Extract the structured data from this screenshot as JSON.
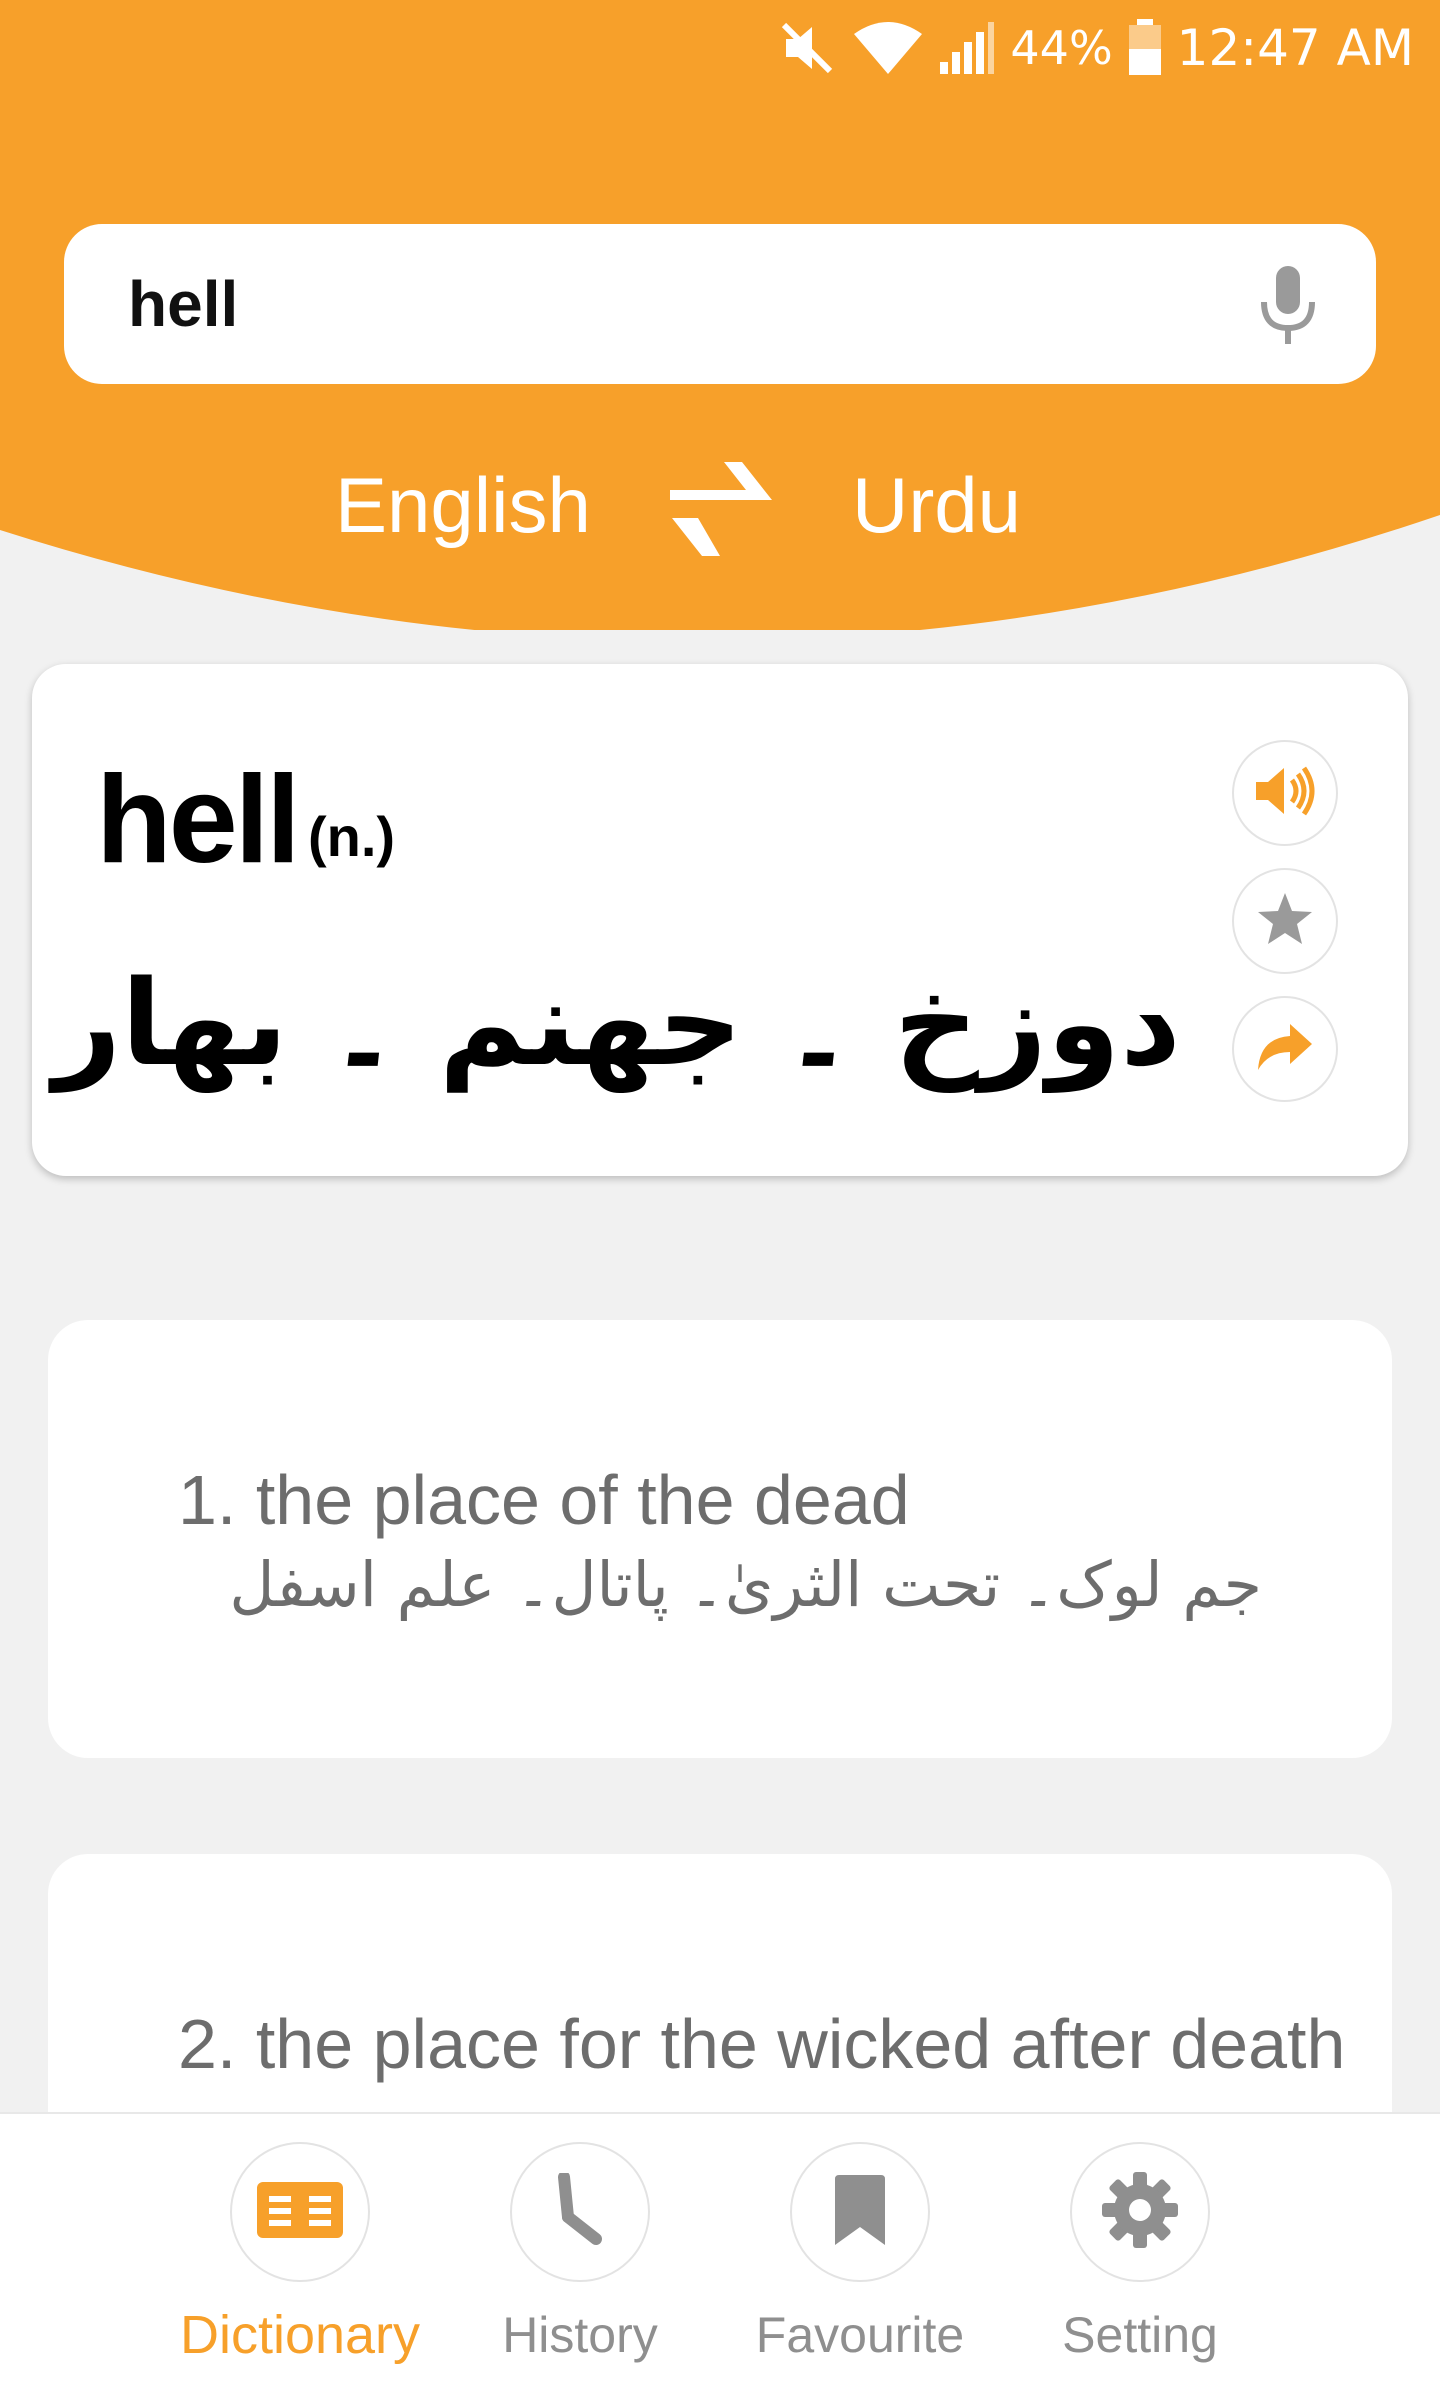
{
  "colors": {
    "accent": "#f7a02a",
    "header_bg": "#f7a02a",
    "page_bg": "#f1f1f1",
    "muted_icon": "#8f8f8f"
  },
  "status_bar": {
    "battery_percent": "44%",
    "time": "12:47 AM",
    "icons": [
      "mute-icon",
      "wifi-icon",
      "signal-icon",
      "battery-icon"
    ]
  },
  "search": {
    "value": "hell",
    "mic_icon": "mic-icon"
  },
  "languages": {
    "source": "English",
    "target": "Urdu",
    "swap_icon": "swap-arrows-icon"
  },
  "word_card": {
    "word": "hell",
    "part_of_speech": "(n.)",
    "translation": "دوزخ ۔ جھنم ۔ بھار",
    "actions": [
      "speaker-icon",
      "star-icon",
      "share-icon"
    ]
  },
  "meanings": [
    {
      "english": "1. the place of the dead",
      "urdu": "جم لوک۔ تحت الثریٰ۔ پاتال۔ علم اسفل"
    },
    {
      "english": "2. the place for the wicked after death"
    }
  ],
  "bottom_nav": {
    "items": [
      {
        "label": "Dictionary",
        "icon": "book-icon",
        "active": true
      },
      {
        "label": "History",
        "icon": "clock-icon",
        "active": false
      },
      {
        "label": "Favourite",
        "icon": "bookmark-icon",
        "active": false
      },
      {
        "label": "Setting",
        "icon": "gear-icon",
        "active": false
      }
    ]
  }
}
